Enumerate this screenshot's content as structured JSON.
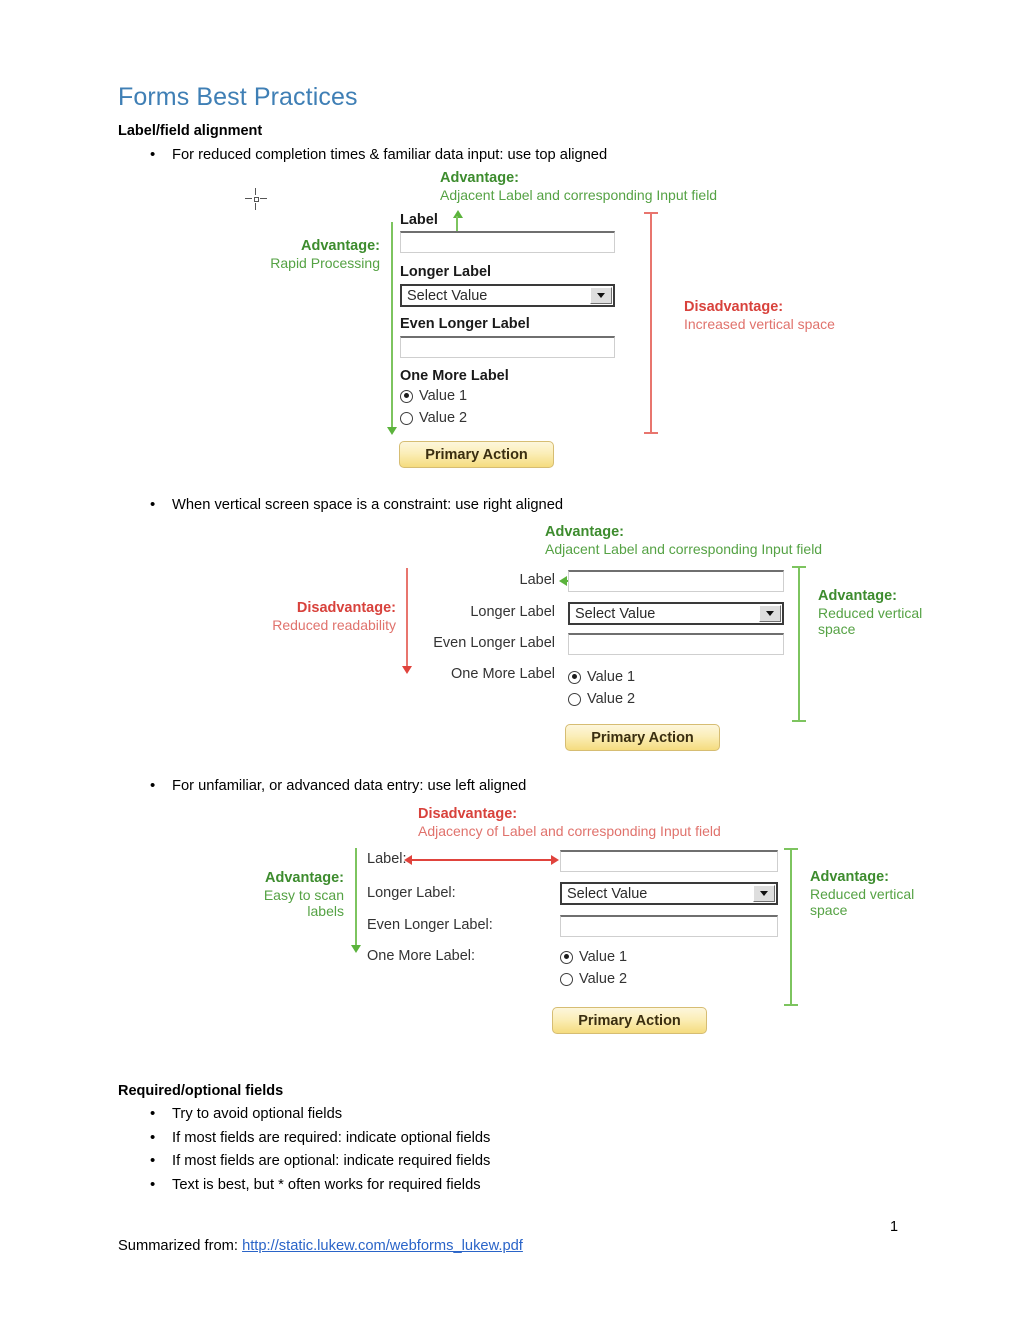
{
  "document": {
    "title": "Forms Best Practices",
    "page_number": "1",
    "footer_prefix": "Summarized from: ",
    "footer_link": "http://static.lukew.com/webforms_lukew.pdf"
  },
  "sections": [
    {
      "heading": "Label/field alignment",
      "bullets": [
        "For reduced completion times & familiar data input: use top aligned",
        "When vertical screen space is a constraint: use right aligned",
        "For unfamiliar, or advanced data entry: use left aligned"
      ]
    },
    {
      "heading": "Required/optional fields",
      "bullets": [
        "Try to avoid optional fields",
        "If most fields are required: indicate optional fields",
        "If most fields are optional: indicate required fields",
        "Text is best, but * often works for required fields"
      ]
    }
  ],
  "form_labels": {
    "label": "Label",
    "longer": "Longer Label",
    "even_longer": "Even Longer Label",
    "one_more": "One More Label",
    "label_colon": "Label:",
    "longer_colon": "Longer Label:",
    "even_longer_colon": "Even Longer Label:",
    "one_more_colon": "One More Label:",
    "select_value": "Select Value",
    "value1": "Value 1",
    "value2": "Value 2",
    "primary_action": "Primary Action"
  },
  "annotations": {
    "advantage": "Advantage:",
    "disadvantage": "Disadvantage:",
    "adjacent_label": "Adjacent Label and corresponding Input field",
    "adjacency_label": "Adjacency of Label and corresponding Input field",
    "rapid_processing": "Rapid Processing",
    "increased_vertical": "Increased vertical space",
    "reduced_readability": "Reduced readability",
    "reduced_vertical_1": "Reduced vertical",
    "reduced_vertical_2": "space",
    "easy_to_scan_1": "Easy to scan",
    "easy_to_scan_2": "labels"
  },
  "colors": {
    "title": "#3f7fb5",
    "advantage_green": "#3d8c2e",
    "disadvantage_red": "#d8423c",
    "link_blue": "#2a64c8",
    "button_gold": "#f5dc7f"
  }
}
